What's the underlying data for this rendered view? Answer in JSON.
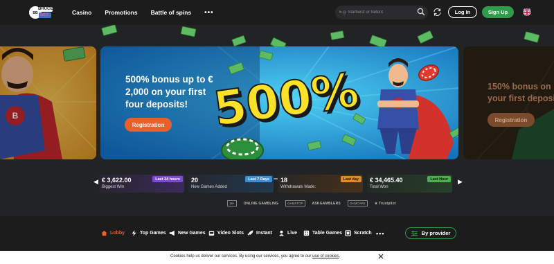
{
  "brand": {
    "logo_text_top": "BRUCE",
    "logo_text_bottom": "BET"
  },
  "nav": {
    "items": [
      "Casino",
      "Promotions",
      "Battle of spins"
    ],
    "more": "•••"
  },
  "search": {
    "placeholder": "E.g. Starburst or Netent"
  },
  "header": {
    "login": "Log In",
    "signup": "Sign Up"
  },
  "carousel": {
    "main_title": "500% bonus up to € 2,000 on your first four deposits!",
    "main_cta": "Registration",
    "main_graphic_text": "500%",
    "right_title": "150% bonus on your first deposit!",
    "right_cta": "Registration",
    "active_dot": 1
  },
  "stats": [
    {
      "value": "€ 3,622.00",
      "label": "Biggest Win",
      "badge": "Last 24 hours",
      "badge_color": "#7d4bd1"
    },
    {
      "value": "20",
      "label": "New Games Added",
      "badge": "Last 7 Days",
      "badge_color": "#3b8fd6"
    },
    {
      "value": "18",
      "label": "Withdrawals Made:",
      "badge": "Last day",
      "badge_color": "#e08a2a"
    },
    {
      "value": "€ 34,465.40",
      "label": "Total Won",
      "badge": "Last Hour",
      "badge_color": "#4caf50"
    }
  ],
  "trust": [
    "18+",
    "ONLINE GAMBLING",
    "GAMSTOP",
    "ASKGAMBLERS",
    "GAMCARE",
    "Trustpilot"
  ],
  "games_nav": {
    "items": [
      {
        "label": "Lobby",
        "icon": "home-icon",
        "active": true
      },
      {
        "label": "Top Games",
        "icon": "lightning-icon",
        "active": false
      },
      {
        "label": "New Games",
        "icon": "megaphone-icon",
        "active": false
      },
      {
        "label": "Video Slots",
        "icon": "slot-machine-icon",
        "active": false
      },
      {
        "label": "Instant",
        "icon": "rocket-icon",
        "active": false
      },
      {
        "label": "Live",
        "icon": "person-icon",
        "active": false
      },
      {
        "label": "Table Games",
        "icon": "dice-icon",
        "active": false
      },
      {
        "label": "Scratch",
        "icon": "scratch-card-icon",
        "active": false
      }
    ],
    "more": "•••",
    "provider": "By provider"
  },
  "cookie": {
    "text": "Cookies help us deliver our services. By using our services, you agree to our ",
    "link": "use of cookies",
    "suffix": "."
  },
  "colors": {
    "accent": "#e8602a",
    "green": "#2e9c4a",
    "background": "#222324"
  }
}
